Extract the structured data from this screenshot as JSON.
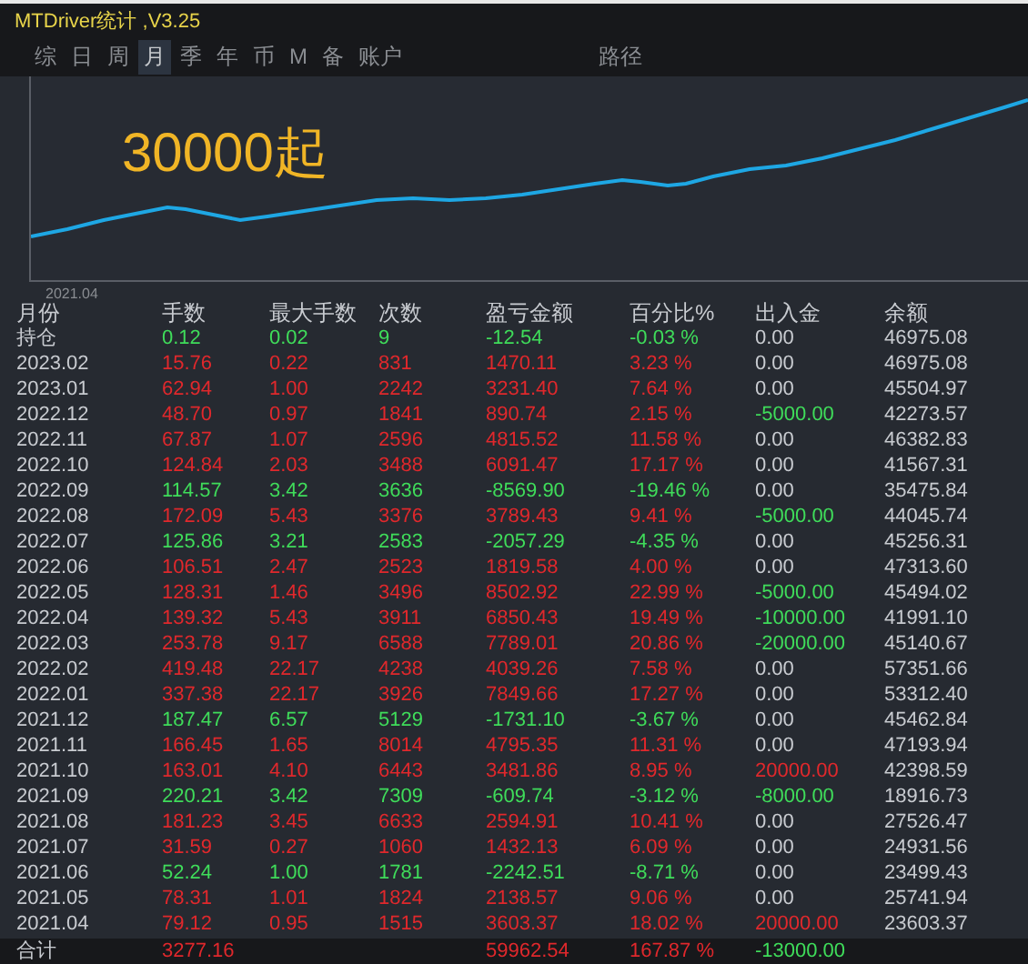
{
  "window": {
    "title": "MTDriver统计 ,V3.25"
  },
  "tabs": [
    {
      "label": "综",
      "selected": false
    },
    {
      "label": "日",
      "selected": false
    },
    {
      "label": "周",
      "selected": false
    },
    {
      "label": "月",
      "selected": true
    },
    {
      "label": "季",
      "selected": false
    },
    {
      "label": "年",
      "selected": false
    },
    {
      "label": "币",
      "selected": false
    },
    {
      "label": "M",
      "selected": false
    },
    {
      "label": "备",
      "selected": false
    },
    {
      "label": "账户",
      "selected": false
    }
  ],
  "path_tab": {
    "label": "路径",
    "selected": false
  },
  "chart": {
    "kind": "picture",
    "annotation": "30000起",
    "start_label": "2021.04"
  },
  "table": {
    "columns": [
      "月份",
      "手数",
      "最大手数",
      "次数",
      "盈亏金额",
      "百分比%",
      "出入金",
      "余额"
    ],
    "rows": [
      {
        "month": "持仓",
        "lots": "0.12",
        "max_lots": "0.02",
        "count": "9",
        "pl": "-12.54",
        "pct": "-0.03 %",
        "flow": {
          "text": "0.00",
          "kind": "none"
        },
        "balance": "46975.08",
        "kind": "loss"
      },
      {
        "month": "2023.02",
        "lots": "15.76",
        "max_lots": "0.22",
        "count": "831",
        "pl": "1470.11",
        "pct": "3.23 %",
        "flow": {
          "text": "0.00",
          "kind": "none"
        },
        "balance": "46975.08",
        "kind": "gain"
      },
      {
        "month": "2023.01",
        "lots": "62.94",
        "max_lots": "1.00",
        "count": "2242",
        "pl": "3231.40",
        "pct": "7.64 %",
        "flow": {
          "text": "0.00",
          "kind": "none"
        },
        "balance": "45504.97",
        "kind": "gain"
      },
      {
        "month": "2022.12",
        "lots": "48.70",
        "max_lots": "0.97",
        "count": "1841",
        "pl": "890.74",
        "pct": "2.15 %",
        "flow": {
          "text": "-5000.00",
          "kind": "out"
        },
        "balance": "42273.57",
        "kind": "gain"
      },
      {
        "month": "2022.11",
        "lots": "67.87",
        "max_lots": "1.07",
        "count": "2596",
        "pl": "4815.52",
        "pct": "11.58 %",
        "flow": {
          "text": "0.00",
          "kind": "none"
        },
        "balance": "46382.83",
        "kind": "gain"
      },
      {
        "month": "2022.10",
        "lots": "124.84",
        "max_lots": "2.03",
        "count": "3488",
        "pl": "6091.47",
        "pct": "17.17 %",
        "flow": {
          "text": "0.00",
          "kind": "none"
        },
        "balance": "41567.31",
        "kind": "gain"
      },
      {
        "month": "2022.09",
        "lots": "114.57",
        "max_lots": "3.42",
        "count": "3636",
        "pl": "-8569.90",
        "pct": "-19.46 %",
        "flow": {
          "text": "0.00",
          "kind": "none"
        },
        "balance": "35475.84",
        "kind": "loss"
      },
      {
        "month": "2022.08",
        "lots": "172.09",
        "max_lots": "5.43",
        "count": "3376",
        "pl": "3789.43",
        "pct": "9.41 %",
        "flow": {
          "text": "-5000.00",
          "kind": "out"
        },
        "balance": "44045.74",
        "kind": "gain"
      },
      {
        "month": "2022.07",
        "lots": "125.86",
        "max_lots": "3.21",
        "count": "2583",
        "pl": "-2057.29",
        "pct": "-4.35 %",
        "flow": {
          "text": "0.00",
          "kind": "none"
        },
        "balance": "45256.31",
        "kind": "loss"
      },
      {
        "month": "2022.06",
        "lots": "106.51",
        "max_lots": "2.47",
        "count": "2523",
        "pl": "1819.58",
        "pct": "4.00 %",
        "flow": {
          "text": "0.00",
          "kind": "none"
        },
        "balance": "47313.60",
        "kind": "gain"
      },
      {
        "month": "2022.05",
        "lots": "128.31",
        "max_lots": "1.46",
        "count": "3496",
        "pl": "8502.92",
        "pct": "22.99 %",
        "flow": {
          "text": "-5000.00",
          "kind": "out"
        },
        "balance": "45494.02",
        "kind": "gain"
      },
      {
        "month": "2022.04",
        "lots": "139.32",
        "max_lots": "5.43",
        "count": "3911",
        "pl": "6850.43",
        "pct": "19.49 %",
        "flow": {
          "text": "-10000.00",
          "kind": "out"
        },
        "balance": "41991.10",
        "kind": "gain"
      },
      {
        "month": "2022.03",
        "lots": "253.78",
        "max_lots": "9.17",
        "count": "6588",
        "pl": "7789.01",
        "pct": "20.86 %",
        "flow": {
          "text": "-20000.00",
          "kind": "out"
        },
        "balance": "45140.67",
        "kind": "gain"
      },
      {
        "month": "2022.02",
        "lots": "419.48",
        "max_lots": "22.17",
        "count": "4238",
        "pl": "4039.26",
        "pct": "7.58 %",
        "flow": {
          "text": "0.00",
          "kind": "none"
        },
        "balance": "57351.66",
        "kind": "gain"
      },
      {
        "month": "2022.01",
        "lots": "337.38",
        "max_lots": "22.17",
        "count": "3926",
        "pl": "7849.66",
        "pct": "17.27 %",
        "flow": {
          "text": "0.00",
          "kind": "none"
        },
        "balance": "53312.40",
        "kind": "gain"
      },
      {
        "month": "2021.12",
        "lots": "187.47",
        "max_lots": "6.57",
        "count": "5129",
        "pl": "-1731.10",
        "pct": "-3.67 %",
        "flow": {
          "text": "0.00",
          "kind": "none"
        },
        "balance": "45462.84",
        "kind": "loss"
      },
      {
        "month": "2021.11",
        "lots": "166.45",
        "max_lots": "1.65",
        "count": "8014",
        "pl": "4795.35",
        "pct": "11.31 %",
        "flow": {
          "text": "0.00",
          "kind": "none"
        },
        "balance": "47193.94",
        "kind": "gain"
      },
      {
        "month": "2021.10",
        "lots": "163.01",
        "max_lots": "4.10",
        "count": "6443",
        "pl": "3481.86",
        "pct": "8.95 %",
        "flow": {
          "text": "20000.00",
          "kind": "in"
        },
        "balance": "42398.59",
        "kind": "gain"
      },
      {
        "month": "2021.09",
        "lots": "220.21",
        "max_lots": "3.42",
        "count": "7309",
        "pl": "-609.74",
        "pct": "-3.12 %",
        "flow": {
          "text": "-8000.00",
          "kind": "out"
        },
        "balance": "18916.73",
        "kind": "loss"
      },
      {
        "month": "2021.08",
        "lots": "181.23",
        "max_lots": "3.45",
        "count": "6633",
        "pl": "2594.91",
        "pct": "10.41 %",
        "flow": {
          "text": "0.00",
          "kind": "none"
        },
        "balance": "27526.47",
        "kind": "gain"
      },
      {
        "month": "2021.07",
        "lots": "31.59",
        "max_lots": "0.27",
        "count": "1060",
        "pl": "1432.13",
        "pct": "6.09 %",
        "flow": {
          "text": "0.00",
          "kind": "none"
        },
        "balance": "24931.56",
        "kind": "gain"
      },
      {
        "month": "2021.06",
        "lots": "52.24",
        "max_lots": "1.00",
        "count": "1781",
        "pl": "-2242.51",
        "pct": "-8.71 %",
        "flow": {
          "text": "0.00",
          "kind": "none"
        },
        "balance": "23499.43",
        "kind": "loss"
      },
      {
        "month": "2021.05",
        "lots": "78.31",
        "max_lots": "1.01",
        "count": "1824",
        "pl": "2138.57",
        "pct": "9.06 %",
        "flow": {
          "text": "0.00",
          "kind": "none"
        },
        "balance": "25741.94",
        "kind": "gain"
      },
      {
        "month": "2021.04",
        "lots": "79.12",
        "max_lots": "0.95",
        "count": "1515",
        "pl": "3603.37",
        "pct": "18.02 %",
        "flow": {
          "text": "20000.00",
          "kind": "in"
        },
        "balance": "23603.37",
        "kind": "gain"
      }
    ],
    "total": {
      "label": "合计",
      "lots": "3277.16",
      "pl": "59962.54",
      "pct": "167.87 %",
      "flow": {
        "text": "-13000.00",
        "kind": "out"
      },
      "kind": "gain"
    }
  }
}
